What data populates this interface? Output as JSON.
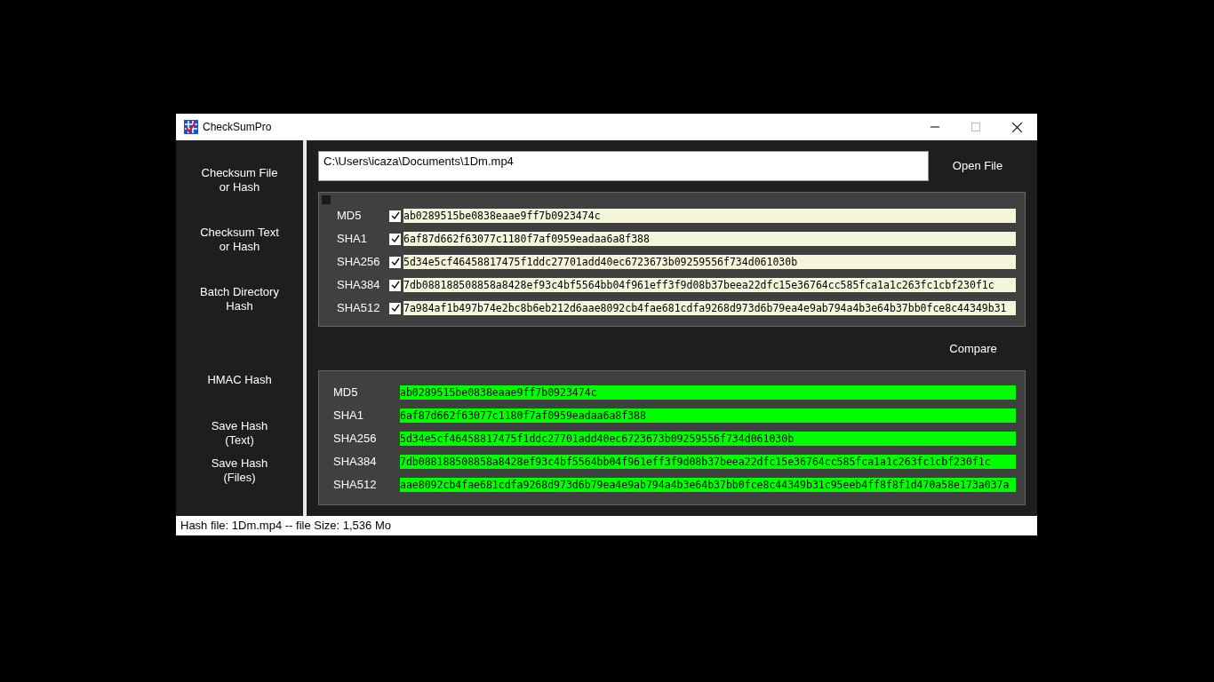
{
  "window": {
    "title": "CheckSumPro"
  },
  "sidebar": {
    "items": [
      {
        "label": "Checksum File\nor Hash"
      },
      {
        "label": "Checksum Text\nor Hash"
      },
      {
        "label": "Batch Directory\nHash"
      },
      {
        "label": "HMAC Hash"
      },
      {
        "label": "Save Hash\n(Text)"
      },
      {
        "label": "Save Hash\n(Files)"
      }
    ]
  },
  "file_path": {
    "value": "C:\\Users\\icaza\\Documents\\1Dm.mp4"
  },
  "open_button": "Open File",
  "hash_panel": {
    "select_all": {
      "checked": false
    },
    "rows": [
      {
        "name": "MD5",
        "checked": true,
        "value": "ab0289515be0838eaae9ff7b0923474c"
      },
      {
        "name": "SHA1",
        "checked": true,
        "value": "6af87d662f63077c1180f7af0959eadaa6a8f388"
      },
      {
        "name": "SHA256",
        "checked": true,
        "value": "5d34e5cf46458817475f1ddc27701add40ec6723673b09259556f734d061030b"
      },
      {
        "name": "SHA384",
        "checked": true,
        "value": "7db088188508858a8428ef93c4bf5564bb04f961eff3f9d08b37beea22dfc15e36764cc585fca1a1c263fc1cbf230f1c"
      },
      {
        "name": "SHA512",
        "checked": true,
        "value": "7a984af1b497b74e2bc8b6eb212d6aae8092cb4fae681cdfa9268d973d6b79ea4e9ab794a4b3e64b37bb0fce8c44349b31"
      }
    ]
  },
  "compare_button": "Compare",
  "compare_panel": {
    "rows": [
      {
        "name": "MD5",
        "match": true,
        "value": "ab0289515be0838eaae9ff7b0923474c"
      },
      {
        "name": "SHA1",
        "match": true,
        "value": "6af87d662f63077c1180f7af0959eadaa6a8f388"
      },
      {
        "name": "SHA256",
        "match": true,
        "value": "5d34e5cf46458817475f1ddc27701add40ec6723673b09259556f734d061030b"
      },
      {
        "name": "SHA384",
        "match": true,
        "value": "7db088188508858a8428ef93c4bf5564bb04f961eff3f9d08b37beea22dfc15e36764cc585fca1a1c263fc1cbf230f1c"
      },
      {
        "name": "SHA512",
        "match": true,
        "value": "aae8092cb4fae681cdfa9268d973d6b79ea4e9ab794a4b3e64b37bb0fce8c44349b31c95eeb4ff8f8f1d470a58e173a037a"
      }
    ]
  },
  "status_bar": {
    "text": "Hash file: 1Dm.mp4 -- file Size: 1,536 Mo"
  }
}
